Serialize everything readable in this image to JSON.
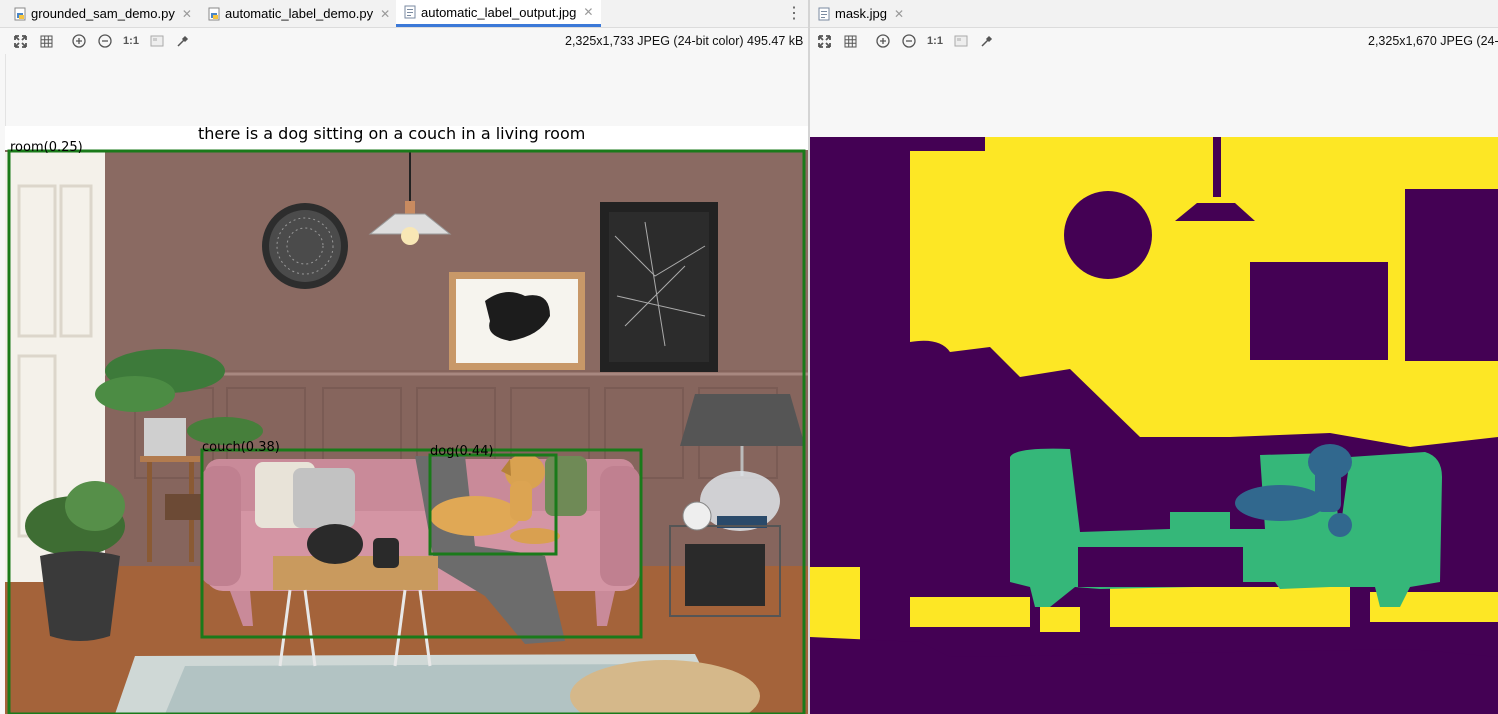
{
  "left": {
    "tabs": [
      {
        "label": "grounded_sam_demo.py",
        "active": false
      },
      {
        "label": "automatic_label_demo.py",
        "active": false
      },
      {
        "label": "automatic_label_output.jpg",
        "active": true
      }
    ],
    "image_info": "2,325x1,733 JPEG (24-bit color) 495.47 kB",
    "caption": "there is a dog sitting on a couch in a living room",
    "boxes": [
      {
        "label": "room(0.25)"
      },
      {
        "label": "couch(0.38)"
      },
      {
        "label": "dog(0.44)"
      }
    ]
  },
  "right": {
    "tabs": [
      {
        "label": "mask.jpg",
        "active": true
      }
    ],
    "image_info": "2,325x1,670 JPEG (24-bit c"
  },
  "toolbar_icons": [
    "fit-screen-icon",
    "grid-icon",
    "zoom-in-icon",
    "zoom-out-icon",
    "actual-size-icon",
    "background-icon",
    "color-picker-icon"
  ],
  "toolbar_text": {
    "actual_size": "1:1"
  },
  "colors": {
    "mask_purple": "#440154",
    "mask_yellow": "#fde725",
    "mask_green": "#35b779",
    "mask_blue": "#31688e",
    "box_green": "#1a7a1a",
    "wall": "#8a6a62"
  }
}
